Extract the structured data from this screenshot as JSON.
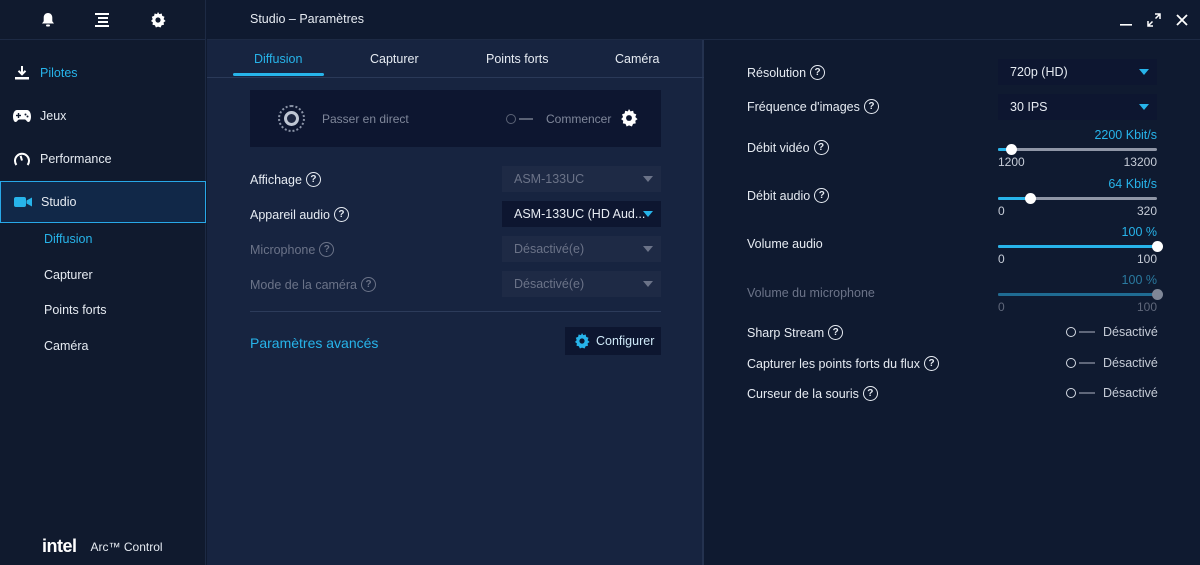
{
  "sidebar": {
    "top_icons": [
      "bell-icon",
      "menu-icon",
      "gear-icon"
    ],
    "nav": [
      {
        "label": "Pilotes",
        "icon": "download-icon"
      },
      {
        "label": "Jeux",
        "icon": "gamepad-icon"
      },
      {
        "label": "Performance",
        "icon": "gauge-icon"
      },
      {
        "label": "Studio",
        "icon": "camera-icon"
      }
    ],
    "subnav": [
      "Diffusion",
      "Capturer",
      "Points forts",
      "Caméra"
    ],
    "brand": {
      "logo": "intel",
      "app": "Arc™ Control"
    }
  },
  "header": {
    "title": "Studio – Paramètres"
  },
  "tabs": [
    "Diffusion",
    "Capturer",
    "Points forts",
    "Caméra"
  ],
  "golive": {
    "label": "Passer en direct",
    "start": "Commencer"
  },
  "form": [
    {
      "label": "Affichage",
      "value": "ASM-133UC",
      "disabled_value": true,
      "disabled_label": false
    },
    {
      "label": "Appareil audio",
      "value": "ASM-133UC (HD Aud...",
      "disabled_value": false,
      "disabled_label": false
    },
    {
      "label": "Microphone",
      "value": "Désactivé(e)",
      "disabled_value": true,
      "disabled_label": true
    },
    {
      "label": "Mode de la caméra",
      "value": "Désactivé(e)",
      "disabled_value": true,
      "disabled_label": true
    }
  ],
  "advanced": {
    "label": "Paramètres avancés",
    "button": "Configurer"
  },
  "right": {
    "resolution": {
      "label": "Résolution",
      "value": "720p (HD)"
    },
    "fps": {
      "label": "Fréquence d'images",
      "value": "30 IPS"
    },
    "video_bitrate": {
      "label": "Débit vidéo",
      "value": "2200 Kbit/s",
      "min": "1200",
      "max": "13200",
      "level": 0.0833
    },
    "audio_bitrate": {
      "label": "Débit audio",
      "value": "64 Kbit/s",
      "min": "0",
      "max": "320",
      "level": 0.2
    },
    "volume": {
      "label": "Volume audio",
      "value": "100 %",
      "min": "0",
      "max": "100",
      "level": 1.0
    },
    "mic_volume": {
      "label": "Volume du microphone",
      "value": "100 %",
      "min": "0",
      "max": "100",
      "level": 1.0
    },
    "toggles": [
      {
        "label": "Sharp Stream",
        "state": "Désactivé",
        "help": true
      },
      {
        "label": "Capturer les points forts du flux",
        "state": "Désactivé",
        "help": true
      },
      {
        "label": "Curseur de la souris",
        "state": "Désactivé",
        "help": true
      }
    ]
  },
  "colors": {
    "accent": "#27b4ea",
    "background": "#0f1a30",
    "panel": "#172440"
  }
}
